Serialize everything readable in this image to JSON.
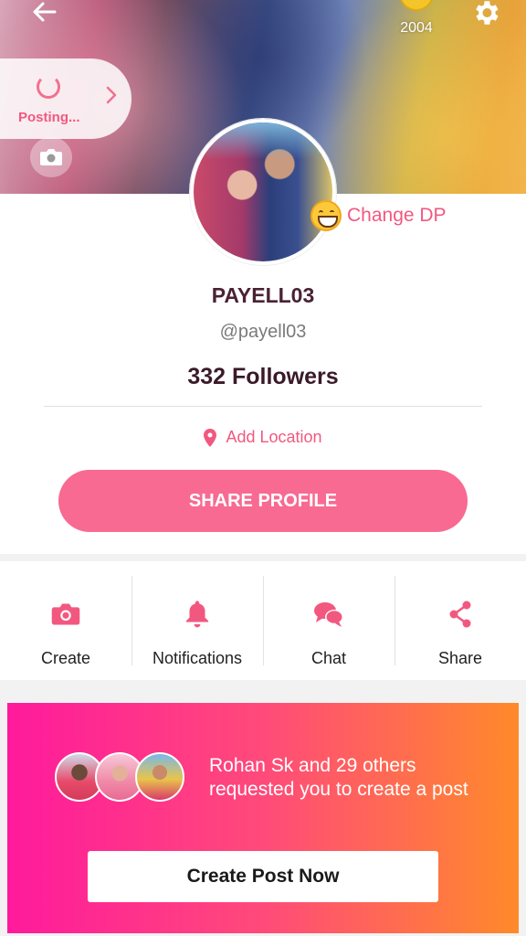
{
  "header": {
    "coins": "2004",
    "posting_label": "Posting..."
  },
  "profile": {
    "change_dp_label": "Change DP",
    "name": "PAYELL03",
    "handle": "@payell03",
    "followers": "332 Followers",
    "add_location_label": "Add Location",
    "share_profile_label": "SHARE PROFILE"
  },
  "actions": [
    {
      "label": "Create",
      "icon": "camera-icon"
    },
    {
      "label": "Notifications",
      "icon": "bell-icon"
    },
    {
      "label": "Chat",
      "icon": "chat-bubbles-icon"
    },
    {
      "label": "Share",
      "icon": "share-icon"
    }
  ],
  "request_banner": {
    "text": "Rohan Sk and 29 others requested you to create a post",
    "button_label": "Create Post Now"
  },
  "colors": {
    "accent": "#f2587f",
    "button": "#f86a92",
    "banner_start": "#ff1a9c",
    "banner_end": "#ff8a2a"
  }
}
